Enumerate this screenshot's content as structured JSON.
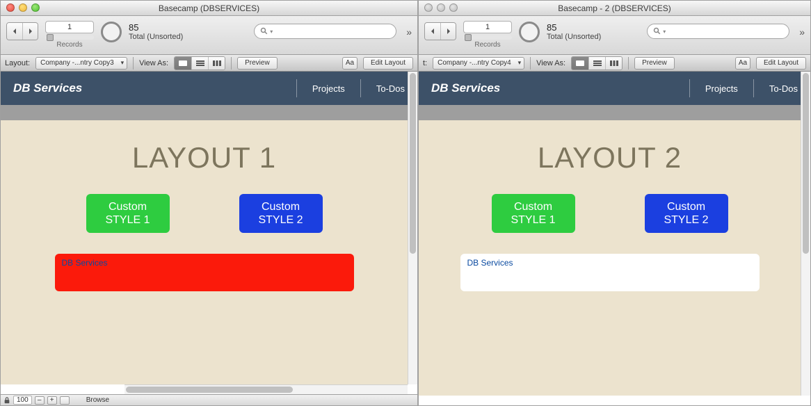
{
  "windows": [
    {
      "title": "Basecamp (DBSERVICES)",
      "traffic_active": true,
      "toolbar": {
        "record_current": "1",
        "records_label": "Records",
        "total_count": "85",
        "total_label": "Total (Unsorted)"
      },
      "layoutbar": {
        "layout_label": "Layout:",
        "layout_value": "Company -...ntry Copy3",
        "view_label": "View As:",
        "preview_label": "Preview",
        "aa_label": "Aa",
        "edit_layout_label": "Edit Layout"
      },
      "content": {
        "brand": "DB Services",
        "nav": {
          "projects": "Projects",
          "todos": "To-Dos"
        },
        "layout_title": "LAYOUT 1",
        "btn1_line1": "Custom",
        "btn1_line2": "STYLE 1",
        "btn2_line1": "Custom",
        "btn2_line2": "STYLE 2",
        "field_value": "DB Services",
        "field_style": "red"
      },
      "statusbar": {
        "zoom": "100",
        "mode": "Browse"
      }
    },
    {
      "title": "Basecamp - 2 (DBSERVICES)",
      "traffic_active": false,
      "toolbar": {
        "record_current": "1",
        "records_label": "Records",
        "total_count": "85",
        "total_label": "Total (Unsorted)"
      },
      "layoutbar": {
        "layout_label": "t:",
        "layout_value": "Company -...ntry Copy4",
        "view_label": "View As:",
        "preview_label": "Preview",
        "aa_label": "Aa",
        "edit_layout_label": "Edit Layout"
      },
      "content": {
        "brand": "DB Services",
        "nav": {
          "projects": "Projects",
          "todos": "To-Dos"
        },
        "layout_title": "LAYOUT 2",
        "btn1_line1": "Custom",
        "btn1_line2": "STYLE 1",
        "btn2_line1": "Custom",
        "btn2_line2": "STYLE 2",
        "field_value": "DB Services",
        "field_style": "white"
      },
      "statusbar": null
    }
  ]
}
